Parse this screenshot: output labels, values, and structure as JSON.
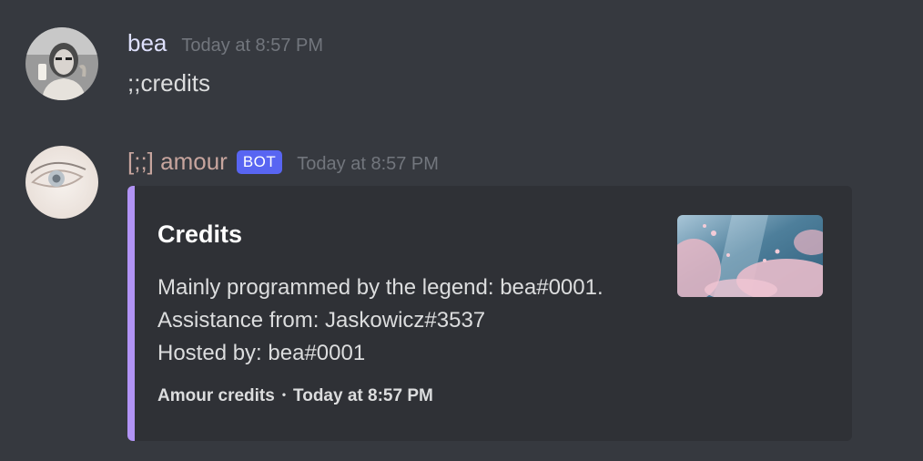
{
  "messages": [
    {
      "username": "bea",
      "username_color": "#dee0fc",
      "timestamp": "Today at 8:57 PM",
      "content": ";;credits",
      "avatar_icon": "user-avatar-photo"
    },
    {
      "username": "[;;] amour",
      "username_color": "#c7a59e",
      "bot_tag": "BOT",
      "timestamp": "Today at 8:57 PM",
      "avatar_icon": "bot-avatar-eye",
      "embed": {
        "accent_color": "#b294f5",
        "title": "Credits",
        "description_lines": [
          "Mainly programmed by the legend: bea#0001.",
          "Assistance from: Jaskowicz#3537",
          "Hosted by: bea#0001"
        ],
        "footer_text": "Amour credits",
        "footer_separator": "•",
        "footer_timestamp": "Today at 8:57 PM",
        "thumbnail_icon": "cherry-blossom-thumbnail"
      }
    }
  ]
}
